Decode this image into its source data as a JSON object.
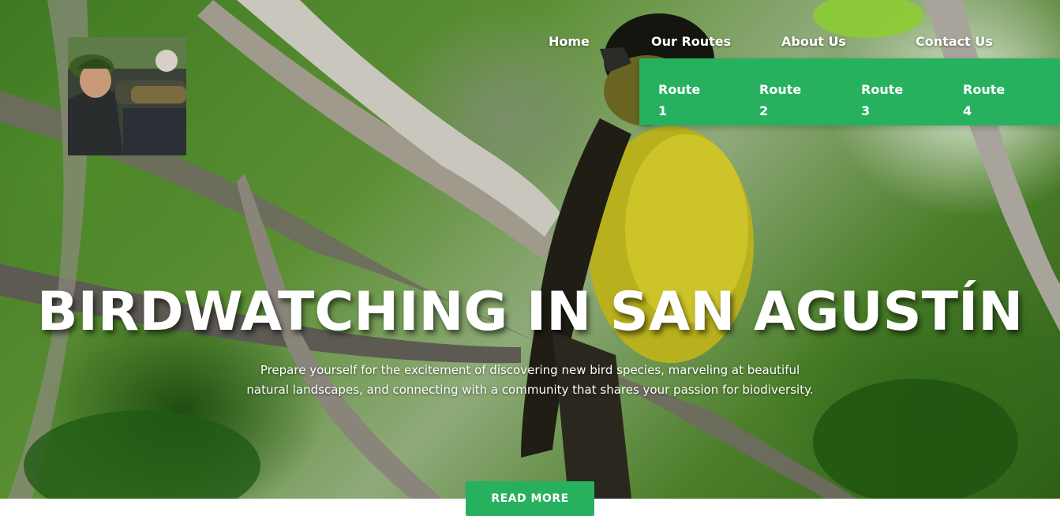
{
  "nav": {
    "items": [
      {
        "label": "Home"
      },
      {
        "label": "Our Routes"
      },
      {
        "label": "About Us"
      },
      {
        "label": "Contact Us"
      }
    ],
    "dropdown": [
      {
        "word": "Route",
        "num": "1"
      },
      {
        "word": "Route",
        "num": "2"
      },
      {
        "word": "Route",
        "num": "3"
      },
      {
        "word": "Route",
        "num": "4"
      }
    ]
  },
  "hero": {
    "title": "BIRDWATCHING IN SAN AGUSTÍN",
    "subtitle": "Prepare yourself for the excitement of discovering new bird species, marveling at beautiful natural landscapes, and connecting with a community that shares your passion for biodiversity.",
    "button": "READ MORE"
  },
  "colors": {
    "accent": "#27b15f",
    "text": "#ffffff"
  }
}
